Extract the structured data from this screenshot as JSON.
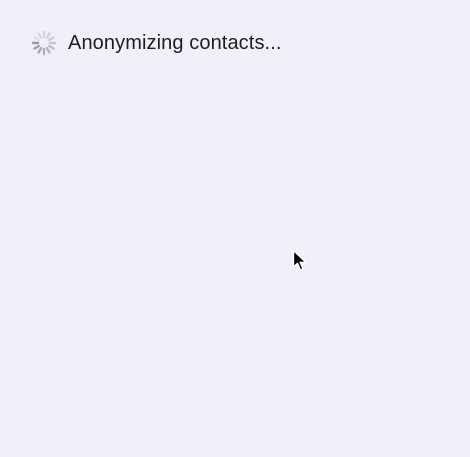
{
  "status": {
    "text": "Anonymizing contacts...",
    "icon": "spinner-icon"
  },
  "colors": {
    "background": "#f0effa",
    "text": "#1e1e1e",
    "spinner": "#8e8e93"
  },
  "cursor": {
    "icon": "arrow-pointer-icon"
  }
}
